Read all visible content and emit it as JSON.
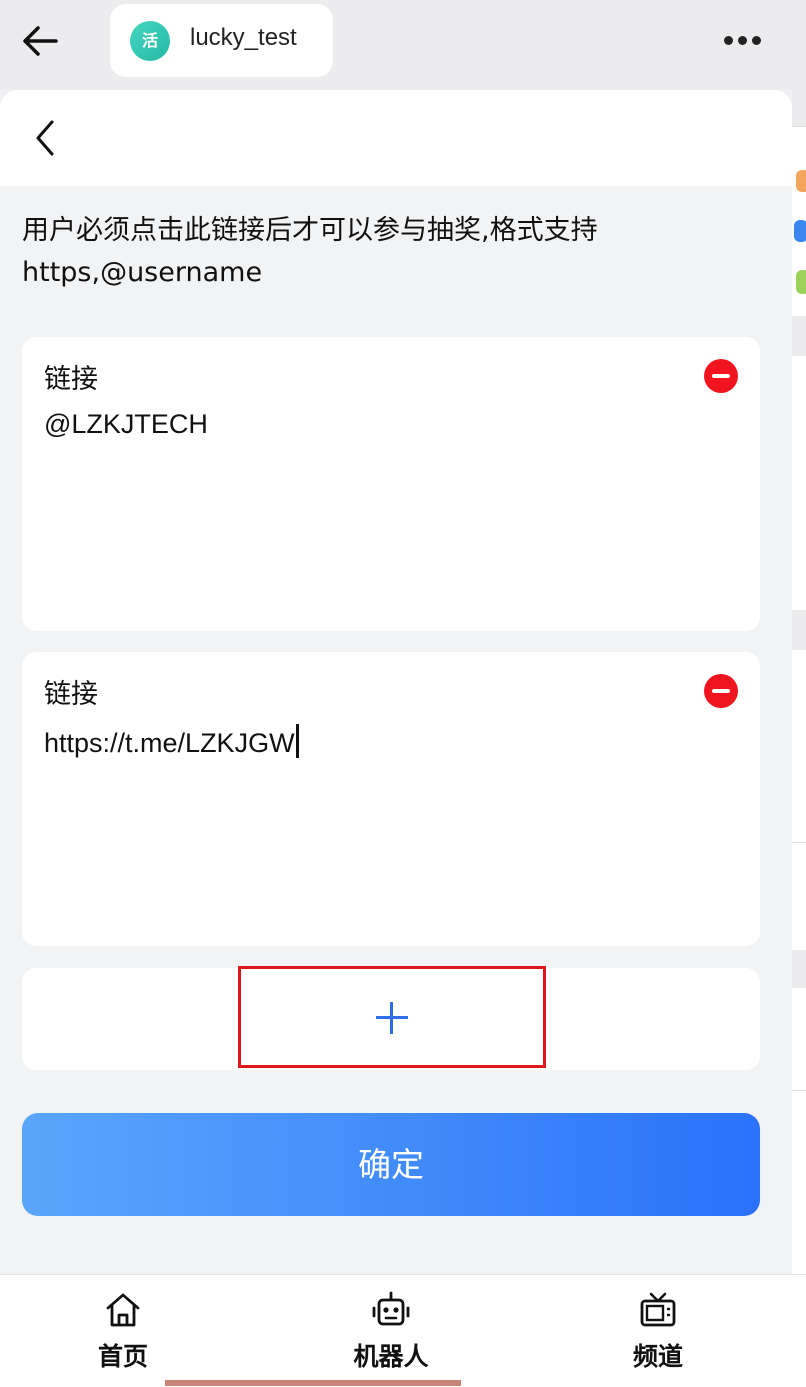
{
  "topbar": {
    "app_name": "lucky_test",
    "app_logo_text": "活"
  },
  "form": {
    "description": "用户必须点击此链接后才可以参与抽奖,格式支持https,@username",
    "links": [
      {
        "label": "链接",
        "value": "@LZKJTECH"
      },
      {
        "label": "链接",
        "value": "https://t.me/LZKJGW"
      }
    ],
    "confirm_label": "确定"
  },
  "tabbar": {
    "items": [
      {
        "label": "首页",
        "icon": "home-icon"
      },
      {
        "label": "机器人",
        "icon": "robot-icon"
      },
      {
        "label": "频道",
        "icon": "tv-icon"
      }
    ]
  },
  "colors": {
    "accent": "#2f6ee8",
    "remove": "#f0141e",
    "highlight_box": "#e0161b",
    "button_gradient_start": "#5aa6fb",
    "button_gradient_end": "#2a72fa"
  }
}
